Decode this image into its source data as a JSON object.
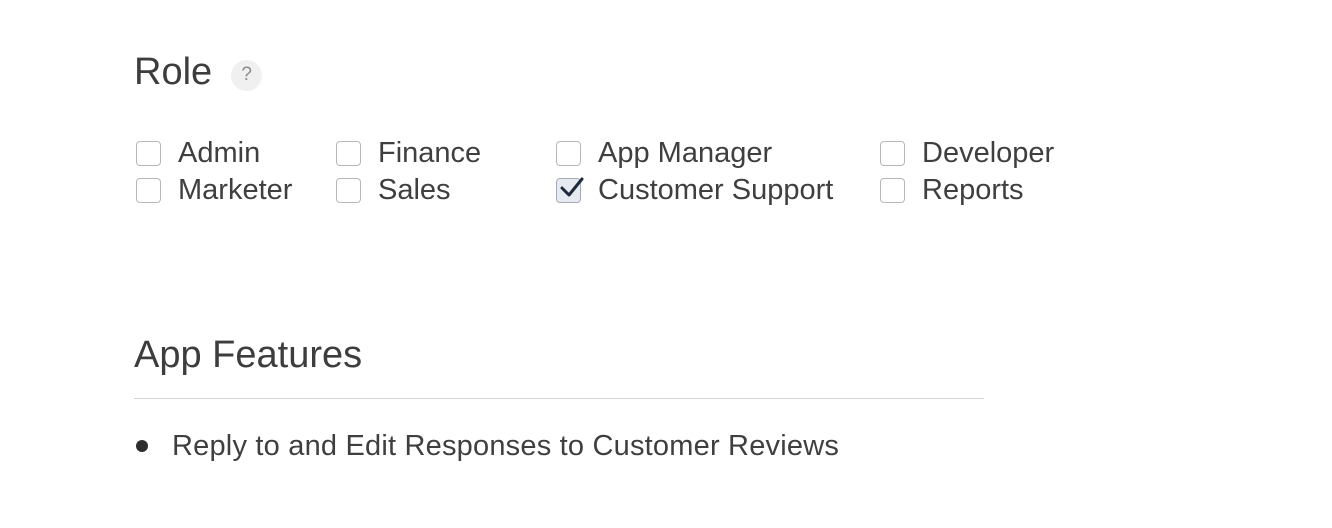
{
  "role": {
    "title": "Role",
    "help_label": "?",
    "options": [
      {
        "label": "Admin",
        "checked": false
      },
      {
        "label": "Finance",
        "checked": false
      },
      {
        "label": "App Manager",
        "checked": false
      },
      {
        "label": "Developer",
        "checked": false
      },
      {
        "label": "Marketer",
        "checked": false
      },
      {
        "label": "Sales",
        "checked": false
      },
      {
        "label": "Customer Support",
        "checked": true
      },
      {
        "label": "Reports",
        "checked": false
      }
    ]
  },
  "app_features": {
    "title": "App Features",
    "items": [
      {
        "text": "Reply to and Edit Responses to Customer Reviews"
      }
    ]
  },
  "colors": {
    "text": "#3f3f3f",
    "checked_fill": "#e6eaf1",
    "checkmark": "#1f2a3a",
    "divider": "#d7d7d7"
  }
}
